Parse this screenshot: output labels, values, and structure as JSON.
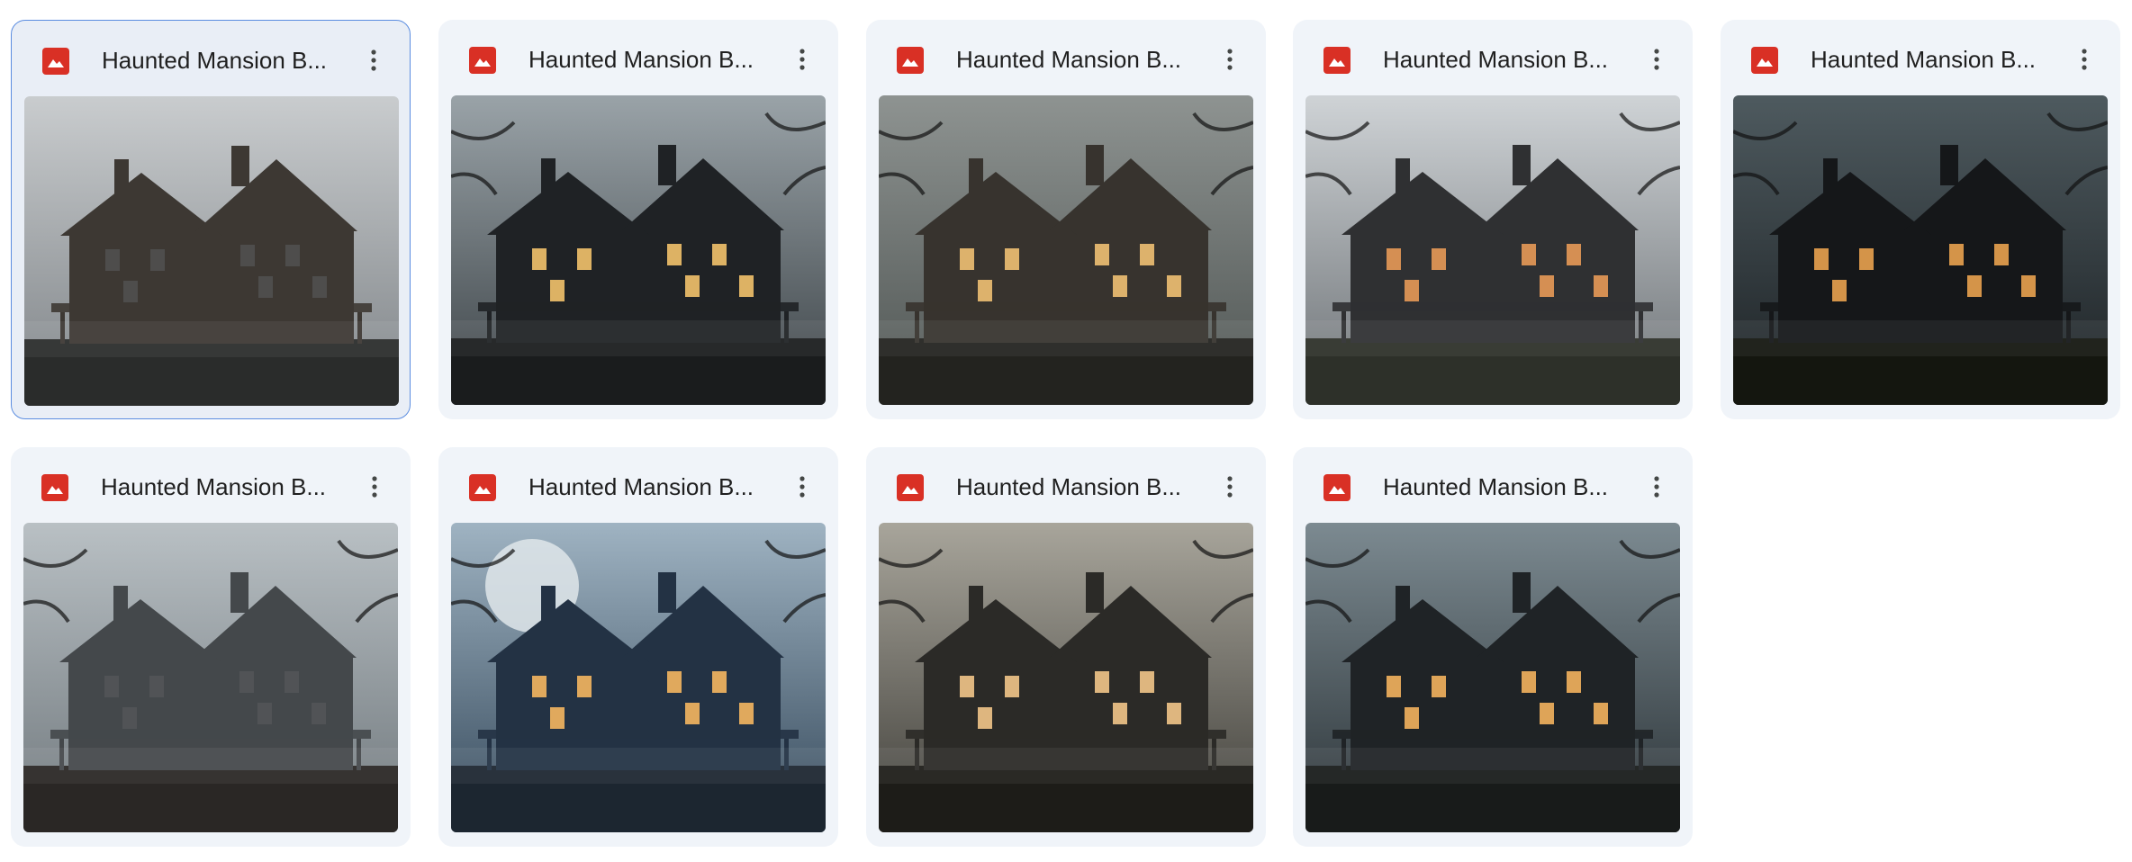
{
  "files": [
    {
      "title": "Haunted Mansion B...",
      "selected": true,
      "thumbnail_alt": "haunted-mansion-1"
    },
    {
      "title": "Haunted Mansion B...",
      "selected": false,
      "thumbnail_alt": "haunted-mansion-2"
    },
    {
      "title": "Haunted Mansion B...",
      "selected": false,
      "thumbnail_alt": "haunted-mansion-3"
    },
    {
      "title": "Haunted Mansion B...",
      "selected": false,
      "thumbnail_alt": "haunted-mansion-4"
    },
    {
      "title": "Haunted Mansion B...",
      "selected": false,
      "thumbnail_alt": "haunted-mansion-5"
    },
    {
      "title": "Haunted Mansion B...",
      "selected": false,
      "thumbnail_alt": "haunted-mansion-6"
    },
    {
      "title": "Haunted Mansion B...",
      "selected": false,
      "thumbnail_alt": "haunted-mansion-7"
    },
    {
      "title": "Haunted Mansion B...",
      "selected": false,
      "thumbnail_alt": "haunted-mansion-8"
    },
    {
      "title": "Haunted Mansion B...",
      "selected": false,
      "thumbnail_alt": "haunted-mansion-9"
    }
  ],
  "icons": {
    "file_type": "image-file-icon",
    "more": "more-vertical-icon"
  },
  "colors": {
    "card_bg": "#f0f4f9",
    "selected_border": "#5b8de0",
    "image_icon": "#d93025"
  }
}
